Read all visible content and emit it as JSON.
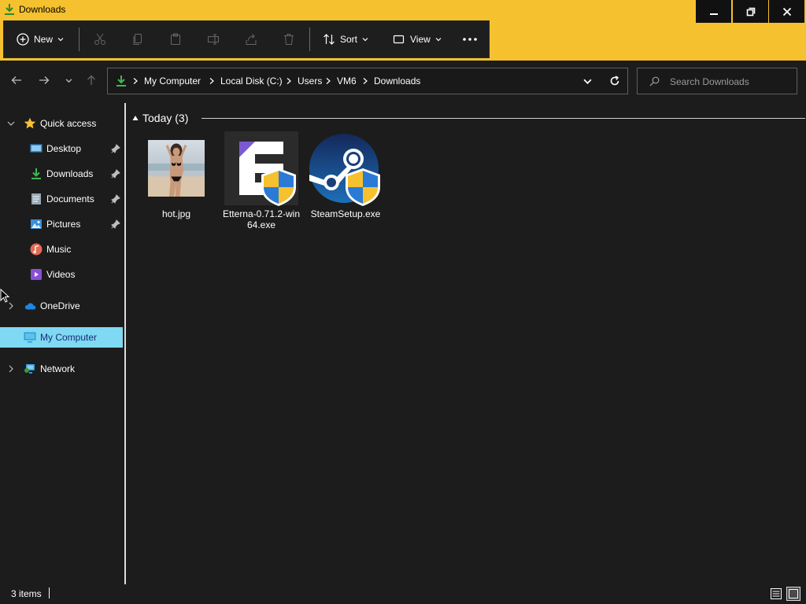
{
  "window": {
    "title": "Downloads",
    "accent_color": "#f5c12e",
    "controls": [
      "minimize-icon",
      "restore-icon",
      "close-icon"
    ]
  },
  "toolbar": {
    "new_label": "New",
    "sort_label": "Sort",
    "view_label": "View",
    "disabled_actions": [
      "cut-icon",
      "copy-icon",
      "paste-icon",
      "rename-icon",
      "share-icon",
      "delete-icon"
    ],
    "more_icon": "more-icon"
  },
  "address": {
    "breadcrumbs": [
      "My Computer",
      "Local Disk (C:)",
      "Users",
      "VM6",
      "Downloads"
    ]
  },
  "search": {
    "placeholder": "Search Downloads"
  },
  "sidebar": {
    "quick_access": "Quick access",
    "items": [
      {
        "label": "Desktop",
        "pinned": true,
        "icon": "desktop-icon"
      },
      {
        "label": "Downloads",
        "pinned": true,
        "icon": "download-icon"
      },
      {
        "label": "Documents",
        "pinned": true,
        "icon": "document-icon"
      },
      {
        "label": "Pictures",
        "pinned": true,
        "icon": "pictures-icon"
      },
      {
        "label": "Music",
        "pinned": false,
        "icon": "music-icon"
      },
      {
        "label": "Videos",
        "pinned": false,
        "icon": "videos-icon"
      }
    ],
    "onedrive": "OneDrive",
    "my_computer": "My Computer",
    "network": "Network",
    "selected_color": "#7fd9f2"
  },
  "content": {
    "group_label": "Today (3)",
    "files": [
      {
        "name": "hot.jpg",
        "icon": "image-thumbnail"
      },
      {
        "name": "Etterna-0.71.2-win64.exe",
        "icon": "etterna-installer-icon"
      },
      {
        "name": "SteamSetup.exe",
        "icon": "steam-installer-icon"
      }
    ]
  },
  "status": {
    "items_count": "3 items"
  }
}
